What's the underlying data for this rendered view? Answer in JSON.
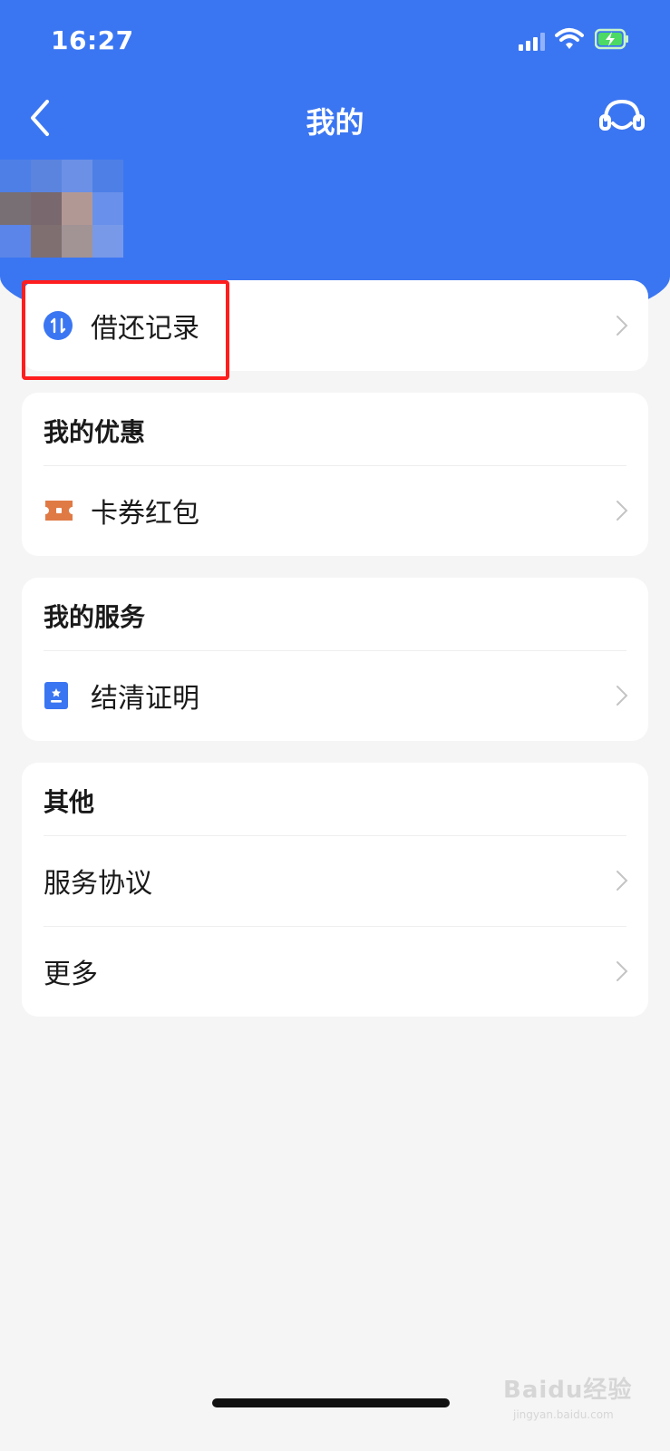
{
  "status_bar": {
    "time": "16:27"
  },
  "nav": {
    "title": "我的",
    "back_icon": "chevron-left-icon",
    "service_icon": "headset-icon"
  },
  "colors": {
    "primary": "#3b76f2",
    "highlight": "#ff1e1e",
    "coupon_icon": "#e07a45"
  },
  "records": {
    "label": "借还记录",
    "icon": "transfer-arrows-icon"
  },
  "offers": {
    "heading": "我的优惠",
    "items": [
      {
        "label": "卡券红包",
        "icon": "ticket-icon"
      }
    ]
  },
  "services": {
    "heading": "我的服务",
    "items": [
      {
        "label": "结清证明",
        "icon": "certificate-icon"
      }
    ]
  },
  "other": {
    "heading": "其他",
    "items": [
      {
        "label": "服务协议"
      },
      {
        "label": "更多"
      }
    ]
  },
  "watermark": {
    "text": "Baidu经验",
    "sub": "jingyan.baidu.com"
  }
}
